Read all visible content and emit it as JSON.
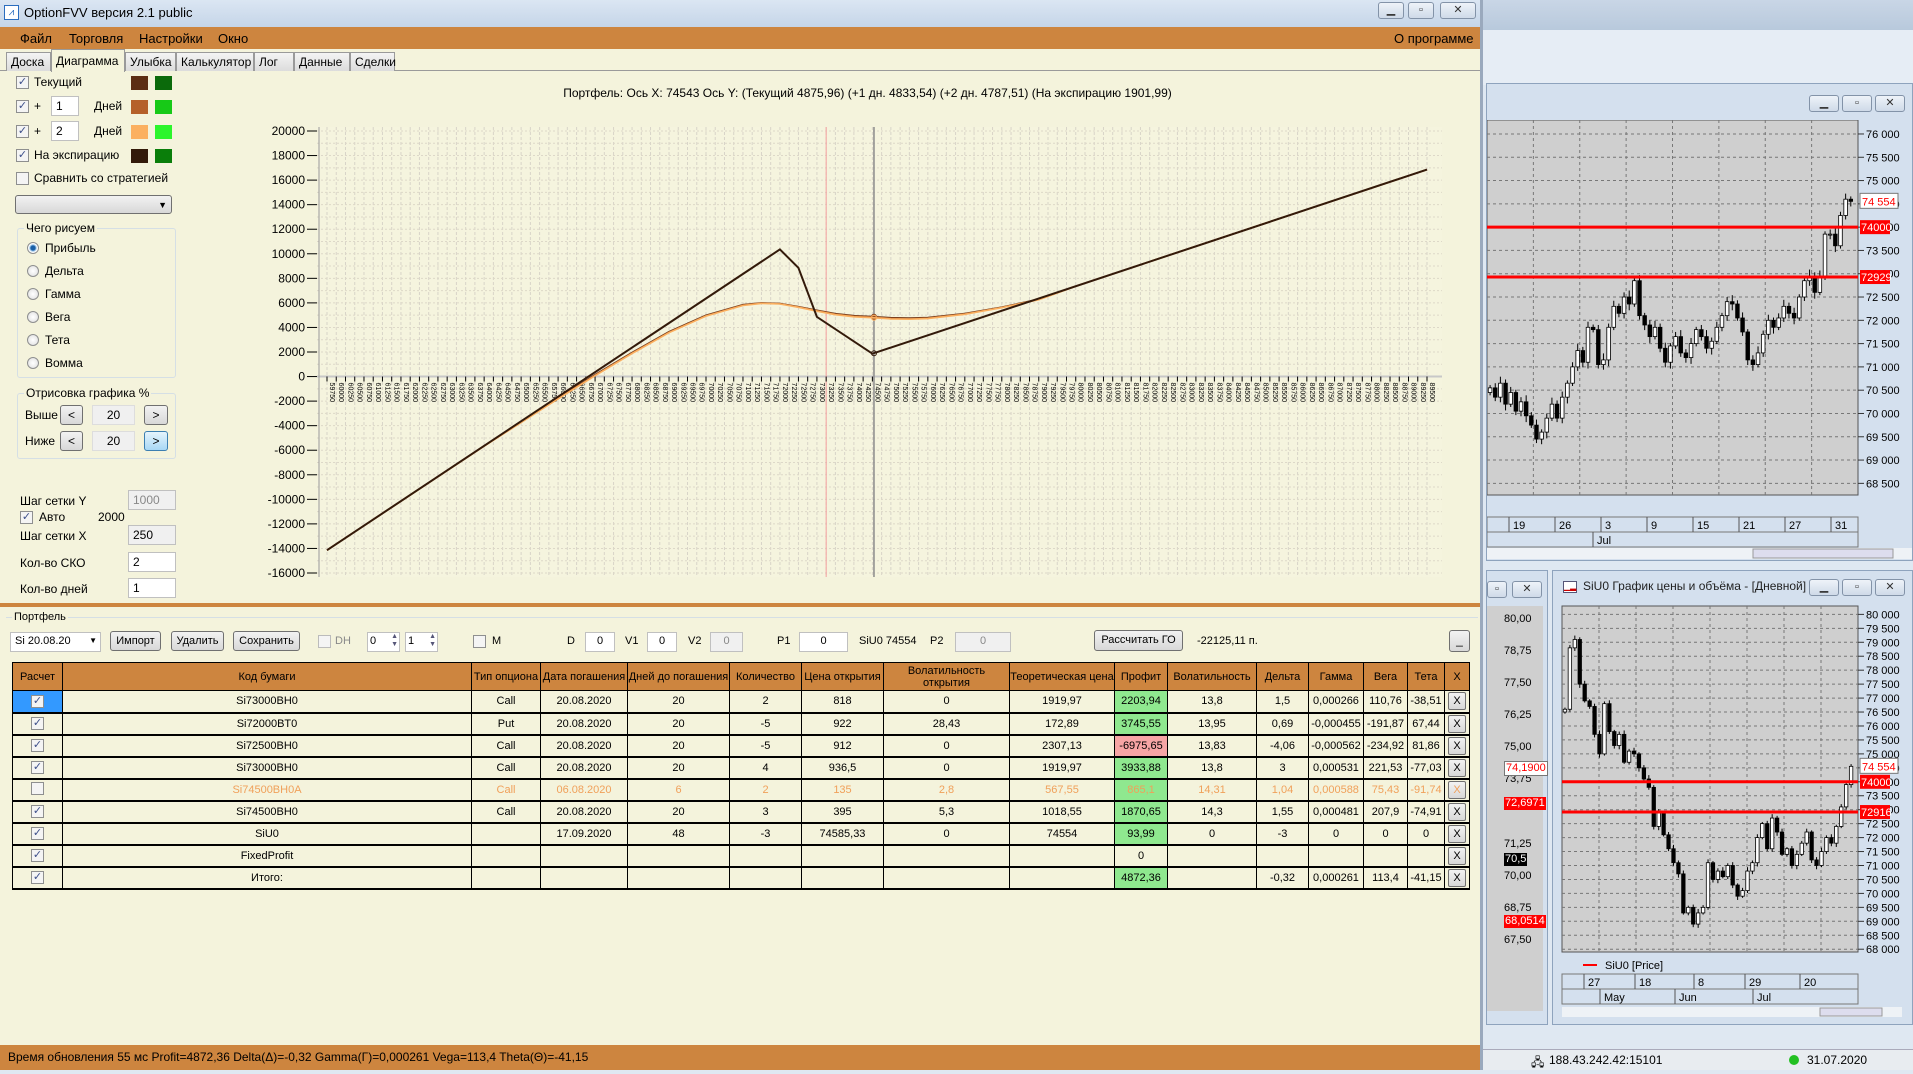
{
  "app": {
    "title": "OptionFVV версия 2.1 public",
    "window_buttons": [
      "minimize",
      "maximize",
      "close"
    ]
  },
  "menu": {
    "items": [
      "Файл",
      "Торговля",
      "Настройки",
      "Окно"
    ],
    "about": "О программе"
  },
  "tabs": [
    {
      "label": "Доска",
      "active": false
    },
    {
      "label": "Диаграмма",
      "active": true
    },
    {
      "label": "Улыбка",
      "active": false
    },
    {
      "label": "Калькулятор",
      "active": false
    },
    {
      "label": "Лог",
      "active": false
    },
    {
      "label": "Данные",
      "active": false
    },
    {
      "label": "Сделки",
      "active": false
    }
  ],
  "left": {
    "curves": [
      {
        "label": "Текущий",
        "checked": true,
        "days": null,
        "color1": "#5c2e14",
        "color2": "#0b6a0b"
      },
      {
        "label": "+",
        "checked": true,
        "days": "1",
        "unit": "Дней",
        "color1": "#b5602a",
        "color2": "#17c917"
      },
      {
        "label": "+",
        "checked": true,
        "days": "2",
        "unit": "Дней",
        "color1": "#fbb060",
        "color2": "#2cf52c"
      },
      {
        "label": "На экспирацию",
        "checked": true,
        "days": null,
        "color1": "#331a0a",
        "color2": "#0a7e0a"
      }
    ],
    "compare": {
      "label": "Сравнить со стратегией",
      "checked": false,
      "select_value": ""
    },
    "draw_group": {
      "title": "Чего рисуем",
      "options": [
        "Прибыль",
        "Дельта",
        "Гамма",
        "Вега",
        "Тета",
        "Вомма"
      ],
      "selected": "Прибыль"
    },
    "render_group": {
      "title": "Отрисовка графика %",
      "above_label": "Выше",
      "above_value": "20",
      "below_label": "Ниже",
      "below_value": "20",
      "prev": "<",
      "next": ">"
    },
    "grid_y_label": "Шаг сетки Y",
    "grid_y_value": "1000",
    "auto_label": "Авто",
    "auto_checked": true,
    "auto_value": "2000",
    "grid_x_label": "Шаг сетки X",
    "grid_x_value": "250",
    "sko_label": "Кол-во СКО",
    "sko_value": "2",
    "days_label": "Кол-во дней",
    "days_value": "1"
  },
  "chart_data": {
    "type": "line",
    "title": "Портфель: Ось X: 74543 Ось Y:  (Текущий 4875,96)  (+1 дн. 4833,54)  (+2 дн. 4787,51)  (На экспирацию 1901,99)",
    "xlim": [
      59750,
      89500
    ],
    "x_tick_step": 250,
    "ylim": [
      -16000,
      20000
    ],
    "y_tick_step": 2000,
    "grid": true,
    "cursor_x": 74543,
    "marker_x": 73250,
    "series": [
      {
        "name": "Текущий",
        "color": "#5c2e14",
        "points": [
          [
            59750,
            -14141
          ],
          [
            64000,
            -5650
          ],
          [
            66000,
            -1750
          ],
          [
            67000,
            150
          ],
          [
            68000,
            1950
          ],
          [
            69000,
            3650
          ],
          [
            70000,
            5000
          ],
          [
            71000,
            5850
          ],
          [
            71500,
            6000
          ],
          [
            72000,
            5950
          ],
          [
            72500,
            5700
          ],
          [
            73000,
            5400
          ],
          [
            73500,
            5120
          ],
          [
            74000,
            4960
          ],
          [
            74543,
            4876
          ],
          [
            75000,
            4790
          ],
          [
            75500,
            4760
          ],
          [
            76000,
            4800
          ],
          [
            77000,
            5130
          ],
          [
            78000,
            5650
          ],
          [
            79000,
            6300
          ],
          [
            80000,
            7359
          ],
          [
            89500,
            16859
          ]
        ]
      },
      {
        "name": "+1 дн.",
        "color": "#b5602a",
        "points": [
          [
            59750,
            -14141
          ],
          [
            64000,
            -5660
          ],
          [
            66000,
            -1780
          ],
          [
            67000,
            110
          ],
          [
            68000,
            1910
          ],
          [
            69000,
            3610
          ],
          [
            70000,
            4960
          ],
          [
            71000,
            5820
          ],
          [
            71500,
            5980
          ],
          [
            72000,
            5930
          ],
          [
            72500,
            5670
          ],
          [
            73000,
            5360
          ],
          [
            73500,
            5080
          ],
          [
            74000,
            4915
          ],
          [
            74543,
            4834
          ],
          [
            75000,
            4745
          ],
          [
            75500,
            4715
          ],
          [
            76000,
            4760
          ],
          [
            77000,
            5100
          ],
          [
            78000,
            5630
          ],
          [
            79000,
            6280
          ],
          [
            80000,
            7359
          ],
          [
            89500,
            16859
          ]
        ]
      },
      {
        "name": "+2 дн.",
        "color": "#fbb060",
        "points": [
          [
            59750,
            -14141
          ],
          [
            64000,
            -5670
          ],
          [
            66000,
            -1810
          ],
          [
            67000,
            70
          ],
          [
            68000,
            1870
          ],
          [
            69000,
            3570
          ],
          [
            70000,
            4920
          ],
          [
            71000,
            5790
          ],
          [
            71500,
            5960
          ],
          [
            72000,
            5910
          ],
          [
            72500,
            5640
          ],
          [
            73000,
            5320
          ],
          [
            73500,
            5040
          ],
          [
            74000,
            4870
          ],
          [
            74543,
            4788
          ],
          [
            75000,
            4700
          ],
          [
            75500,
            4670
          ],
          [
            76000,
            4720
          ],
          [
            77000,
            5070
          ],
          [
            78000,
            5610
          ],
          [
            79000,
            6260
          ],
          [
            80000,
            7359
          ],
          [
            89500,
            16859
          ]
        ]
      },
      {
        "name": "На экспирацию",
        "color": "#331a0a",
        "points": [
          [
            59750,
            -14141
          ],
          [
            72000,
            10359
          ],
          [
            72500,
            8859
          ],
          [
            73000,
            4859
          ],
          [
            74500,
            1859
          ],
          [
            89500,
            16859
          ]
        ]
      }
    ]
  },
  "portfolio": {
    "title": "Портфель",
    "series_select": "Si 20.08.20",
    "import": "Импорт",
    "delete": "Удалить",
    "save": "Сохранить",
    "dh_label": "DH",
    "dh_checked": false,
    "spin1": "0",
    "spin2": "1",
    "m_label": "M",
    "m_checked": false,
    "d_label": "D",
    "d_value": "0",
    "v1_label": "V1",
    "v1_value": "0",
    "v2_label": "V2",
    "v2_value": "0",
    "p1_label": "P1",
    "p1_value": "0",
    "price_label": "SiU0 74554",
    "p2_label": "P2",
    "p2_value": "0",
    "calc_go": "Рассчитать ГО",
    "go_value": "-22125,11 п.",
    "collapse": "_",
    "columns": [
      "Расчет",
      "Код бумаги",
      "Тип опциона",
      "Дата погашения",
      "Дней до погашения",
      "Количество",
      "Цена открытия",
      "Волатильность открытия",
      "Теоретическая цена",
      "Профит",
      "Волатильность",
      "Дельта",
      "Гамма",
      "Вега",
      "Тета",
      "X"
    ],
    "rows": [
      {
        "checked": true,
        "cells": [
          "Si73000BH0",
          "Call",
          "20.08.2020",
          "20",
          "2",
          "818",
          "0",
          "1919,97",
          "2203,94",
          "13,8",
          "1,5",
          "0,000266",
          "110,76",
          "-38,51"
        ],
        "profit": "pos",
        "state": "selected"
      },
      {
        "checked": true,
        "cells": [
          "Si72000BT0",
          "Put",
          "20.08.2020",
          "20",
          "-5",
          "922",
          "28,43",
          "172,89",
          "3745,55",
          "13,95",
          "0,69",
          "-0,000455",
          "-191,87",
          "67,44"
        ],
        "profit": "pos"
      },
      {
        "checked": true,
        "cells": [
          "Si72500BH0",
          "Call",
          "20.08.2020",
          "20",
          "-5",
          "912",
          "0",
          "2307,13",
          "-6975,65",
          "13,83",
          "-4,06",
          "-0,000562",
          "-234,92",
          "81,86"
        ],
        "profit": "neg"
      },
      {
        "checked": true,
        "cells": [
          "Si73000BH0",
          "Call",
          "20.08.2020",
          "20",
          "4",
          "936,5",
          "0",
          "1919,97",
          "3933,88",
          "13,8",
          "3",
          "0,000531",
          "221,53",
          "-77,03"
        ],
        "profit": "pos"
      },
      {
        "checked": false,
        "cells": [
          "Si74500BH0A",
          "Call",
          "06.08.2020",
          "6",
          "2",
          "135",
          "2,8",
          "567,55",
          "865,1",
          "14,31",
          "1,04",
          "0,000588",
          "75,43",
          "-91,74"
        ],
        "profit": "pos",
        "state": "disabled"
      },
      {
        "checked": true,
        "cells": [
          "Si74500BH0",
          "Call",
          "20.08.2020",
          "20",
          "3",
          "395",
          "5,3",
          "1018,55",
          "1870,65",
          "14,3",
          "1,55",
          "0,000481",
          "207,9",
          "-74,91"
        ],
        "profit": "pos"
      },
      {
        "checked": true,
        "cells": [
          "SiU0",
          "",
          "17.09.2020",
          "48",
          "-3",
          "74585,33",
          "0",
          "74554",
          "93,99",
          "0",
          "-3",
          "0",
          "0",
          "0"
        ],
        "profit": "pos"
      },
      {
        "checked": true,
        "cells": [
          "FixedProfit",
          "",
          "",
          "",
          "",
          "",
          "",
          "",
          "0",
          "",
          "",
          "",
          "",
          ""
        ],
        "profit": "none"
      },
      {
        "checked": true,
        "cells": [
          "Итого:",
          "",
          "",
          "",
          "",
          "",
          "",
          "",
          "4872,36",
          "",
          "-0,32",
          "0,000261",
          "113,4",
          "-41,15"
        ],
        "profit": "pos"
      }
    ],
    "remove_label": "X"
  },
  "status": "Время обновления 55 мс  Profit=4872,36 Delta(Δ)=-0,32 Gamma(Γ)=0,000261 Vega=113,4 Theta(Θ)=-41,15",
  "quik": {
    "chart1": {
      "y_labels": [
        "76 000",
        "75 500",
        "75 000",
        "74 500",
        "74 000",
        "73 500",
        "73 000",
        "72 500",
        "72 000",
        "71 500",
        "71 000",
        "70 500",
        "70 000",
        "69 500",
        "69 000",
        "68 500"
      ],
      "ylim": [
        68250,
        76300
      ],
      "date_labels": [
        "19",
        "26",
        "3",
        "9",
        "15",
        "21",
        "27",
        "31"
      ],
      "month_labels": [
        "Jul"
      ],
      "last_price": "74 554",
      "levels": [
        {
          "label": "74000",
          "value": 74000
        },
        {
          "label": "72929",
          "value": 72929
        }
      ],
      "closes": [
        70550,
        70350,
        70650,
        70200,
        70450,
        70050,
        70250,
        69950,
        69750,
        69450,
        69600,
        69900,
        70200,
        69900,
        70350,
        70650,
        71000,
        71350,
        71100,
        71850,
        71800,
        71050,
        71150,
        71850,
        72300,
        72150,
        72500,
        72350,
        72850,
        72100,
        71900,
        71650,
        71850,
        71400,
        71100,
        71450,
        71650,
        71300,
        71200,
        71500,
        71800,
        71650,
        71400,
        71550,
        71850,
        72100,
        72400,
        72350,
        72050,
        71750,
        71150,
        71050,
        71300,
        71700,
        72000,
        71850,
        72050,
        72300,
        72150,
        72050,
        72500,
        72850,
        72950,
        72600,
        72950,
        73850,
        73850,
        73600,
        74250,
        74600,
        74554
      ]
    },
    "chart2": {
      "title": "SiU0 График цены и объёма - [Дневной]",
      "legend": "SiU0 [Price]",
      "y_labels": [
        "80 000",
        "79 500",
        "79 000",
        "78 500",
        "78 000",
        "77 500",
        "77 000",
        "76 500",
        "76 000",
        "75 500",
        "75 000",
        "74 500",
        "74 000",
        "73 500",
        "73 000",
        "72 500",
        "72 000",
        "71 500",
        "71 000",
        "70 500",
        "70 000",
        "69 500",
        "69 000",
        "68 500",
        "68 000"
      ],
      "ylim": [
        67900,
        80300
      ],
      "date_labels": [
        "27",
        "18",
        "8",
        "29",
        "20"
      ],
      "month_labels": [
        "May",
        "Jun",
        "Jul"
      ],
      "last_price": "74 554",
      "levels": [
        {
          "label": "74000",
          "value": 74000
        },
        {
          "label": "72916",
          "value": 72916
        }
      ],
      "closes": [
        76600,
        78800,
        79100,
        77500,
        76900,
        76700,
        75700,
        75000,
        76800,
        75800,
        75300,
        75700,
        74700,
        75100,
        75000,
        74500,
        74100,
        73800,
        72400,
        72900,
        72100,
        71600,
        71100,
        70700,
        69300,
        69500,
        68900,
        69300,
        69500,
        71100,
        70500,
        70800,
        70600,
        71000,
        70300,
        69900,
        70100,
        70800,
        71100,
        72000,
        72500,
        71600,
        72700,
        72200,
        71400,
        71600,
        71000,
        71400,
        71800,
        72200,
        71200,
        71000,
        71500,
        72000,
        71800,
        72400,
        73100,
        73900,
        74554
      ]
    },
    "chart0": {
      "y_labels": [
        "80,00",
        "78,75",
        "77,50",
        "76,25",
        "75,00",
        "73,75",
        "71,25",
        "70,00",
        "68,75",
        "67,50"
      ],
      "tags": [
        {
          "label": "74,1900",
          "style": "outline"
        },
        {
          "label": "72,6971",
          "style": "red"
        },
        {
          "label": "70,5",
          "style": "black"
        },
        {
          "label": "68,0514",
          "style": "red"
        }
      ]
    },
    "status_ip": "188.43.242.42:15101",
    "status_date": "31.07.2020",
    "connection_color": "#22c022"
  }
}
